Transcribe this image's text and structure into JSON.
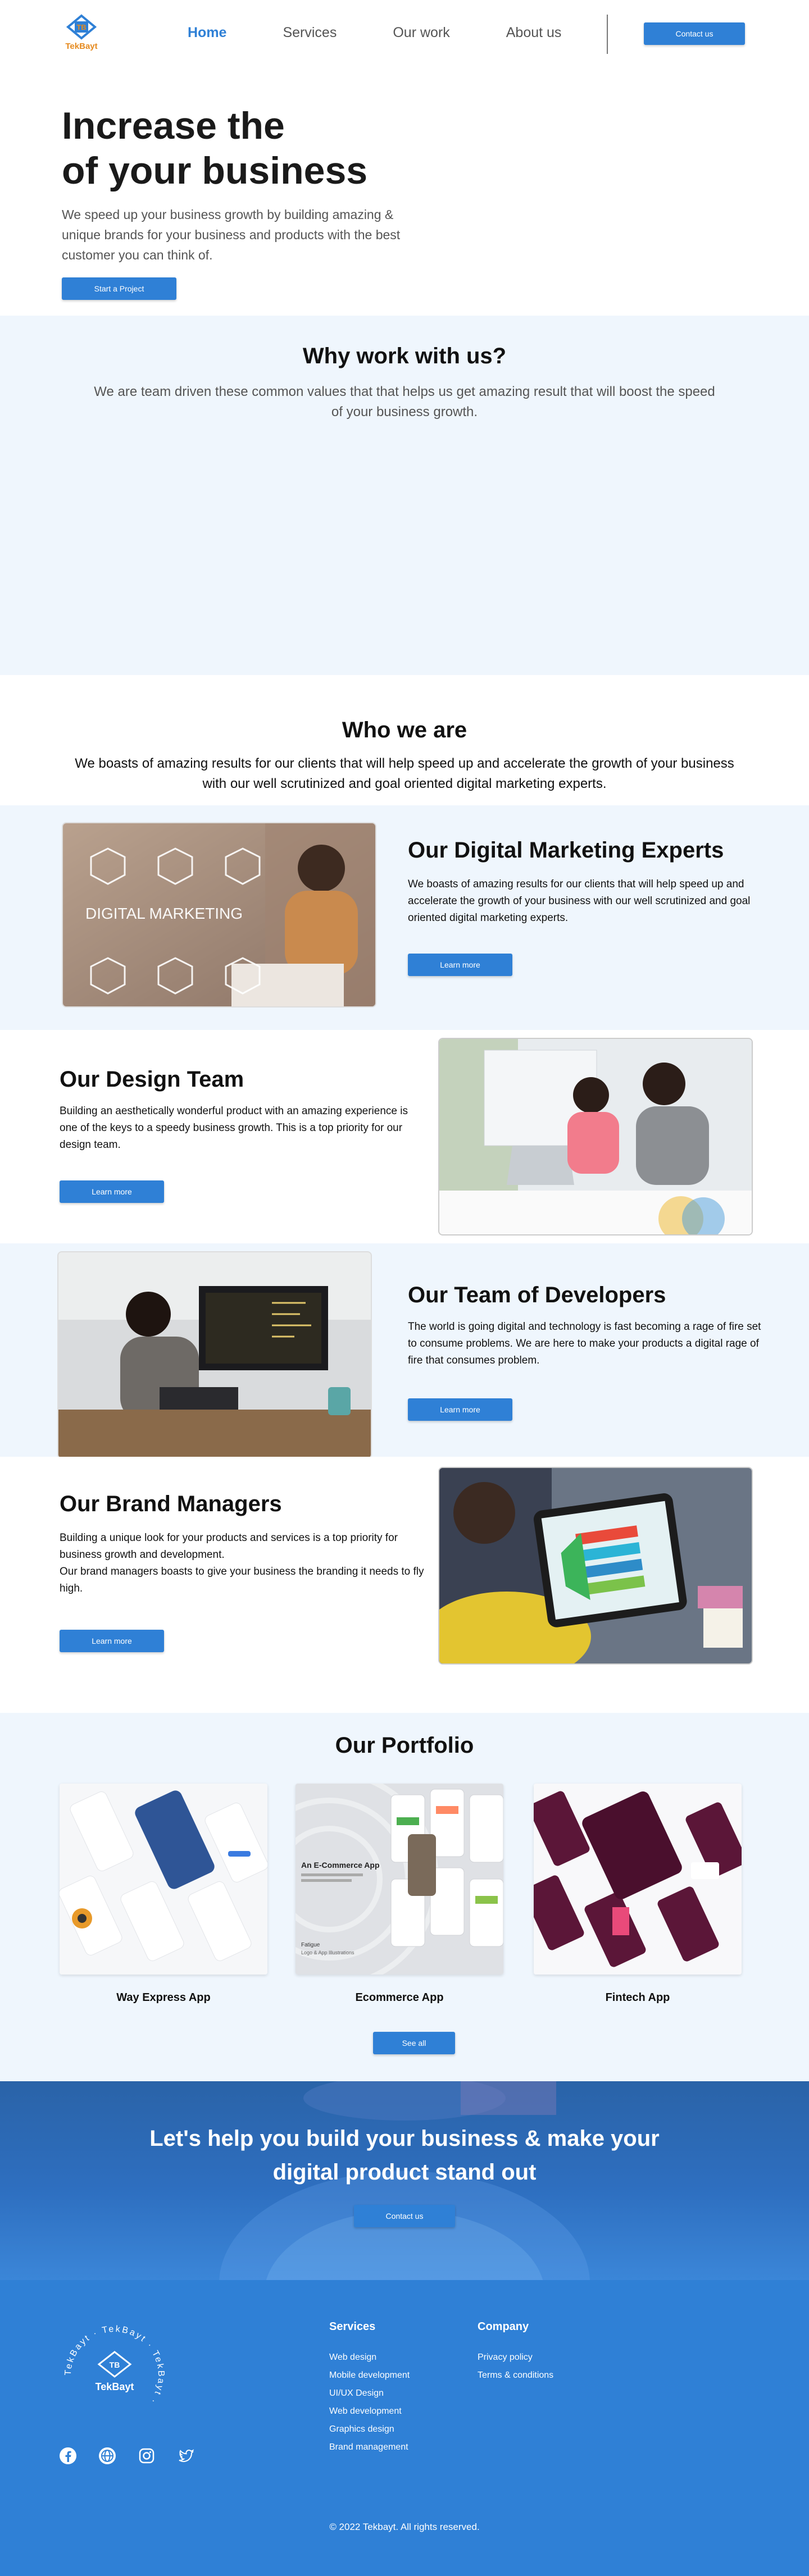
{
  "brand": {
    "name": "TekBayt",
    "mark": "TB"
  },
  "nav": {
    "links": [
      "Home",
      "Services",
      "Our work",
      "About us"
    ],
    "cta": "Contact us"
  },
  "hero": {
    "title_line1": "Increase the",
    "title_line2": "of your business",
    "description": "We speed up your business growth by building amazing & unique brands for your business and products with the best customer you can think of.",
    "button": "Start a Project"
  },
  "why": {
    "title": "Why work with us?",
    "description": "We are team driven these common values that that helps us get amazing result that will boost the speed of your business growth."
  },
  "who": {
    "title": "Who we are",
    "description": "We boasts of amazing results for our clients that will help speed up and accelerate the growth of your business with our well scrutinized and goal oriented digital marketing  experts."
  },
  "teams": [
    {
      "title": "Our Digital Marketing Experts",
      "description": "We boasts of amazing results for our clients that will help speed up and accelerate the growth of your business with our well scrutinized and goal oriented digital marketing  experts.",
      "button": "Learn more",
      "image_text": "DIGITAL MARKETING"
    },
    {
      "title": "Our Design Team",
      "description": "Building an aesthetically wonderful product with an amazing experience is one of the keys to a speedy business growth. This is a top priority for our design team.",
      "button": "Learn more"
    },
    {
      "title": "Our Team of Developers",
      "description": "The world is going digital and technology is fast becoming a rage of fire set to consume problems. We are here to make your products a digital rage of fire that consumes problem.",
      "button": "Learn more"
    },
    {
      "title": "Our Brand Managers",
      "description": "Building a unique look for your products and services is a top priority for business growth and development.",
      "description2": "Our brand managers boasts to give your business the branding it needs to fly high.",
      "button": "Learn more"
    }
  ],
  "portfolio": {
    "title": "Our Portfolio",
    "items": [
      {
        "caption": "Way Express App"
      },
      {
        "caption": "Ecommerce App",
        "mock_heading": "An E-Commerce App",
        "mock_sub": "Fatigue",
        "mock_sub2": "Logo & App Illustrations"
      },
      {
        "caption": "Fintech App"
      }
    ],
    "button": "See all"
  },
  "cta": {
    "title_line1": "Let's help you build your business & make your",
    "title_line2": "digital product stand out",
    "button": "Contact us"
  },
  "footer": {
    "badge_ring": "TekBayt  ·  TekBayt  ·  TekBayt  ·",
    "services_title": "Services",
    "services": [
      "Web design",
      "Mobile development",
      "UI/UX Design",
      "Web development",
      "Graphics design",
      "Brand management"
    ],
    "company_title": "Company",
    "company": [
      "Privacy policy",
      "Terms & conditions"
    ],
    "socials": [
      "facebook-icon",
      "globe-icon",
      "instagram-icon",
      "twitter-icon"
    ],
    "copyright": "© 2022 Tekbayt. All rights reserved."
  },
  "colors": {
    "primary": "#2f80d6",
    "accent": "#e58a1f",
    "light_bg": "#eff6fd"
  }
}
